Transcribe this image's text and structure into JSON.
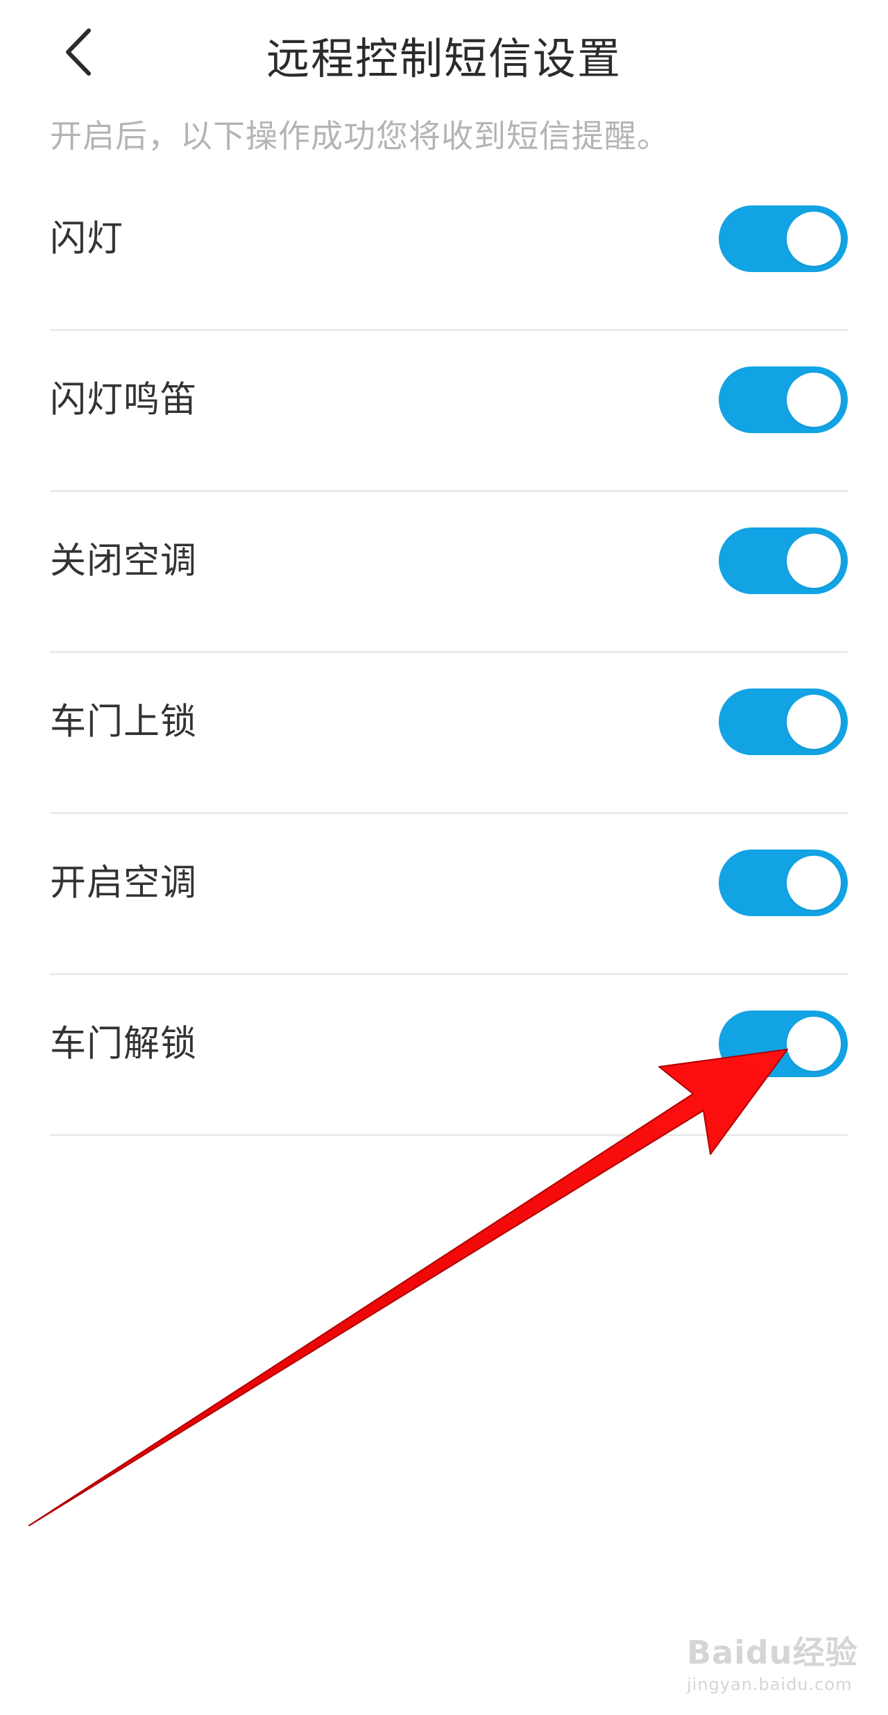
{
  "header": {
    "title": "远程控制短信设置",
    "back_icon": "chevron-left-icon"
  },
  "description": "开启后，以下操作成功您将收到短信提醒。",
  "accent_color": "#12a3e4",
  "settings": [
    {
      "label": "闪灯",
      "enabled": true
    },
    {
      "label": "闪灯鸣笛",
      "enabled": true
    },
    {
      "label": "关闭空调",
      "enabled": true
    },
    {
      "label": "车门上锁",
      "enabled": true
    },
    {
      "label": "开启空调",
      "enabled": true
    },
    {
      "label": "车门解锁",
      "enabled": true
    }
  ],
  "annotation": {
    "type": "arrow",
    "color": "#ff0000",
    "target": "车门解锁"
  },
  "watermark": {
    "main": "Baidu经验",
    "sub": "jingyan.baidu.com"
  }
}
